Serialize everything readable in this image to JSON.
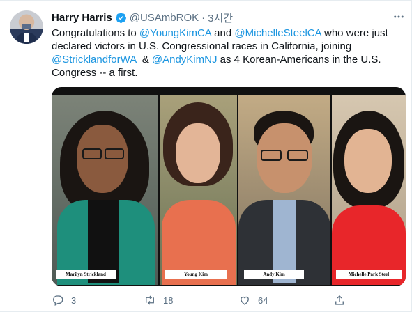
{
  "tweet": {
    "name": "Harry Harris",
    "handle": "@USAmbROK",
    "separator": "·",
    "time": "3시간",
    "text": {
      "p1": "Congratulations to ",
      "m1": "@YoungKimCA",
      "p2": " and ",
      "m2": "@MichelleSteelCA",
      "p3": " who were just declared victors in U.S. Congressional races in California, joining ",
      "m3": "@StricklandforWA",
      "p4": "  & ",
      "m4": "@AndyKimNJ",
      "p5": " as 4 Korean-Americans in the U.S. Congress -- a first."
    },
    "media": {
      "captions": [
        "Marilyn Strickland",
        "Young Kim",
        "Andy Kim",
        "Michelle Park Steel"
      ]
    },
    "actions": {
      "replies": "3",
      "retweets": "18",
      "likes": "64"
    },
    "colors": {
      "link": "#1b95e0",
      "verified": "#1da1f2",
      "secondary": "#5b7083"
    },
    "icons": [
      "verified-badge-icon",
      "more-icon",
      "reply-icon",
      "retweet-icon",
      "like-icon",
      "share-icon"
    ]
  }
}
